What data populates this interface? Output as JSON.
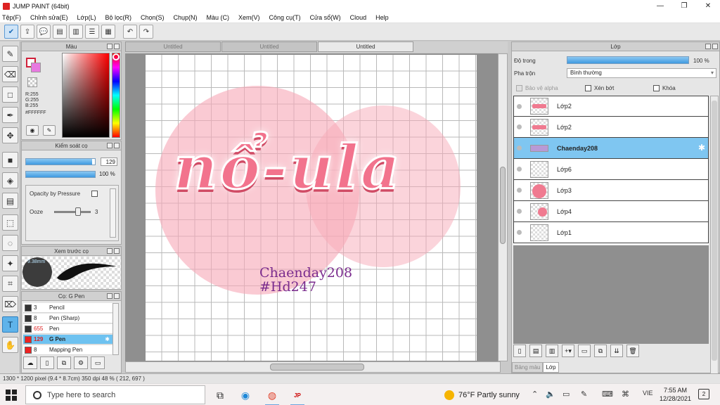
{
  "window": {
    "title": "JUMP PAINT (64bit)",
    "controls": [
      "—",
      "❐",
      "✕"
    ]
  },
  "menu": [
    "Tệp(F)",
    "Chỉnh sửa(E)",
    "Lớp(L)",
    "Bộ lọc(R)",
    "Chọn(S)",
    "Chụp(N)",
    "Màu (C)",
    "Xem(V)",
    "Công cụ(T)",
    "Cửa sổ(W)",
    "Cloud",
    "Help"
  ],
  "color_panel": {
    "title": "Màu",
    "r": "R:255",
    "g": "G:255",
    "b": "B:255",
    "hex": "#FFFFFF",
    "fg_color": "#d0203a",
    "bg_color": "#e879e0"
  },
  "brush_control": {
    "title": "Kiểm soát cọ",
    "size_value": "129",
    "size_fraction": 0.96,
    "opacity_value": "100 %",
    "opacity_fraction": 1.0,
    "opacity_pressure_label": "Opacity by Pressure",
    "ooze_label": "Ooze",
    "ooze_value": "3"
  },
  "brush_preview": {
    "title": "Xem trước cọ",
    "size_label": "9.38mm"
  },
  "brush_list": {
    "title": "Cọ: G Pen",
    "items": [
      {
        "num": "3",
        "name": "Pencil",
        "red": false,
        "selected": false
      },
      {
        "num": "8",
        "name": "Pen (Sharp)",
        "red": false,
        "selected": false
      },
      {
        "num": "655",
        "name": "Pen",
        "red": true,
        "selected": false
      },
      {
        "num": "129",
        "name": "G Pen",
        "red": true,
        "selected": true
      },
      {
        "num": "8",
        "name": "Mapping Pen",
        "red": true,
        "selected": false
      }
    ]
  },
  "canvas_tabs": [
    "Untitled",
    "Untitled",
    "Untitled"
  ],
  "artwork": {
    "title": "nổ-ula",
    "signature_1": "Chaenday208",
    "signature_2": "#Hd247"
  },
  "layer_panel": {
    "title": "Lớp",
    "opacity_label": "Độ trong",
    "opacity_value": "100 %",
    "blend_label": "Pha trộn",
    "blend_value": "Bình thường",
    "protect_alpha_label": "Bảo vệ alpha",
    "clipping_label": "Xén bớt",
    "lock_label": "Khóa",
    "layers": [
      {
        "name": "Lớp2",
        "selected": false
      },
      {
        "name": "Lớp2",
        "selected": false
      },
      {
        "name": "Chaenday208",
        "selected": true
      },
      {
        "name": "Lớp6",
        "selected": false
      },
      {
        "name": "Lớp3",
        "selected": false
      },
      {
        "name": "Lớp4",
        "selected": false
      },
      {
        "name": "Lớp1",
        "selected": false
      }
    ],
    "tab_palette": "Bảng màu",
    "tab_layer": "Lớp"
  },
  "status": {
    "text": "1300 * 1200 pixel   (9.4 * 8.7cm)   350 dpi   48 %   ( 212, 697 )"
  },
  "taskbar": {
    "search_placeholder": "Type here to search",
    "weather": "76°F  Partly sunny",
    "lang": "VIE",
    "time": "7:55 AM",
    "date": "12/28/2021",
    "notifications": "2"
  }
}
